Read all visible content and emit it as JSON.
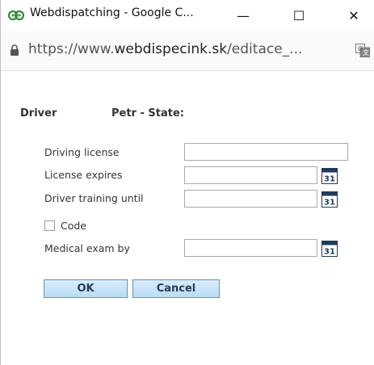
{
  "window": {
    "title": "Webdispatching - Google C...",
    "url_host": "https://www.",
    "url_domain": "webdispecink.sk",
    "url_path": "/editace_...",
    "controls": {
      "minimize": "—",
      "maximize": "☐",
      "close": "✕"
    }
  },
  "form": {
    "driver_label": "Driver",
    "driver_name": "Petr - State:",
    "fields": {
      "driving_license": {
        "label": "Driving license",
        "value": ""
      },
      "license_expires": {
        "label": "License expires",
        "value": ""
      },
      "driver_training_until": {
        "label": "Driver training until",
        "value": ""
      },
      "code": {
        "label": "Code",
        "checked": false
      },
      "medical_exam_by": {
        "label": "Medical exam by",
        "value": ""
      }
    },
    "calendar_icon_label": "31",
    "buttons": {
      "ok": "OK",
      "cancel": "Cancel"
    }
  },
  "colors": {
    "button_fill": "#c6e3f8",
    "button_border": "#6d8fb5",
    "calendar_icon": "#1f3b5c"
  }
}
